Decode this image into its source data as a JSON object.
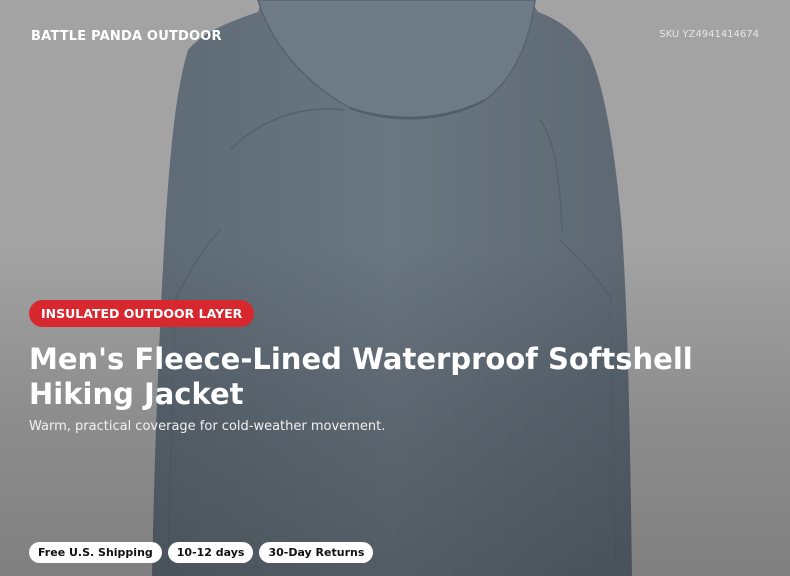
{
  "brand": "BATTLE PANDA OUTDOOR",
  "sku": "SKU YZ4941414674",
  "badge": "INSULATED OUTDOOR LAYER",
  "title": "Men's Fleece-Lined Waterproof Softshell Hiking Jacket",
  "subtitle": "Warm, practical coverage for cold-weather movement.",
  "chips": [
    "Free U.S. Shipping",
    "10-12 days",
    "30-Day Returns"
  ],
  "colors": {
    "background": "#a3a3a3",
    "jacket": "#64707c",
    "badge": "#d7282f",
    "chip_bg": "#ffffff"
  }
}
